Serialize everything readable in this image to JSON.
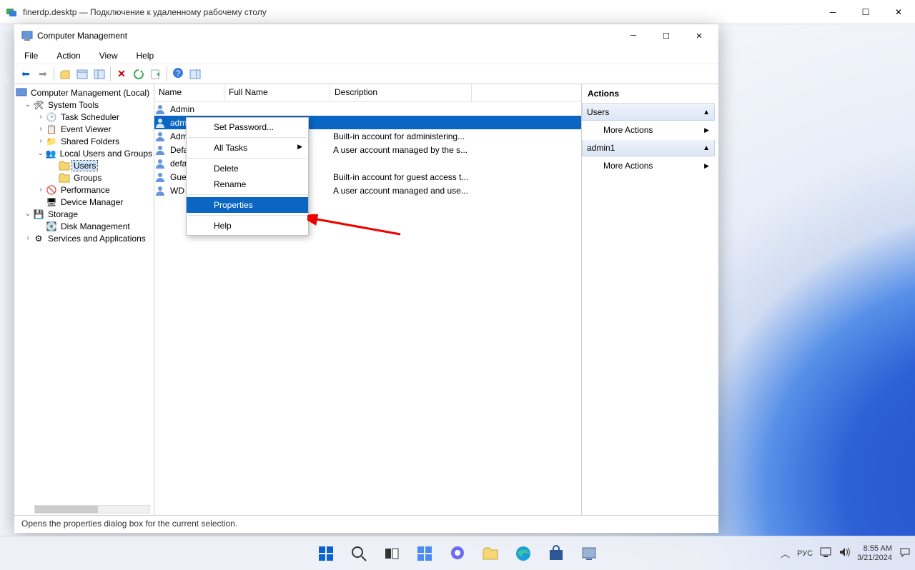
{
  "outer_window": {
    "title": "finerdp.desktp — Подключение к удаленному рабочему столу"
  },
  "mmc": {
    "title": "Computer Management",
    "menu": [
      "File",
      "Action",
      "View",
      "Help"
    ],
    "status": "Opens the properties dialog box for the current selection."
  },
  "tree": {
    "root": "Computer Management (Local)",
    "n1": "System Tools",
    "n1a": "Task Scheduler",
    "n1b": "Event Viewer",
    "n1c": "Shared Folders",
    "n1d": "Local Users and Groups",
    "n1d1": "Users",
    "n1d2": "Groups",
    "n1e": "Performance",
    "n1f": "Device Manager",
    "n2": "Storage",
    "n2a": "Disk Management",
    "n3": "Services and Applications"
  },
  "list": {
    "cols": {
      "name": "Name",
      "fullname": "Full Name",
      "desc": "Description"
    },
    "rows": [
      {
        "name": "Admin",
        "desc": ""
      },
      {
        "name": "admin1",
        "desc": ""
      },
      {
        "name": "Adm",
        "desc": "Built-in account for administering..."
      },
      {
        "name": "Defa",
        "desc": "A user account managed by the s..."
      },
      {
        "name": "defa",
        "desc": ""
      },
      {
        "name": "Gue",
        "desc": "Built-in account for guest access t..."
      },
      {
        "name": "WD",
        "desc": "A user account managed and use..."
      }
    ]
  },
  "ctx": {
    "set_password": "Set Password...",
    "all_tasks": "All Tasks",
    "delete": "Delete",
    "rename": "Rename",
    "properties": "Properties",
    "help": "Help"
  },
  "actions": {
    "header": "Actions",
    "g1": "Users",
    "g1a": "More Actions",
    "g2": "admin1",
    "g2a": "More Actions"
  },
  "taskbar": {
    "lang": "РУС",
    "time": "8:55 AM",
    "date": "3/21/2024"
  }
}
